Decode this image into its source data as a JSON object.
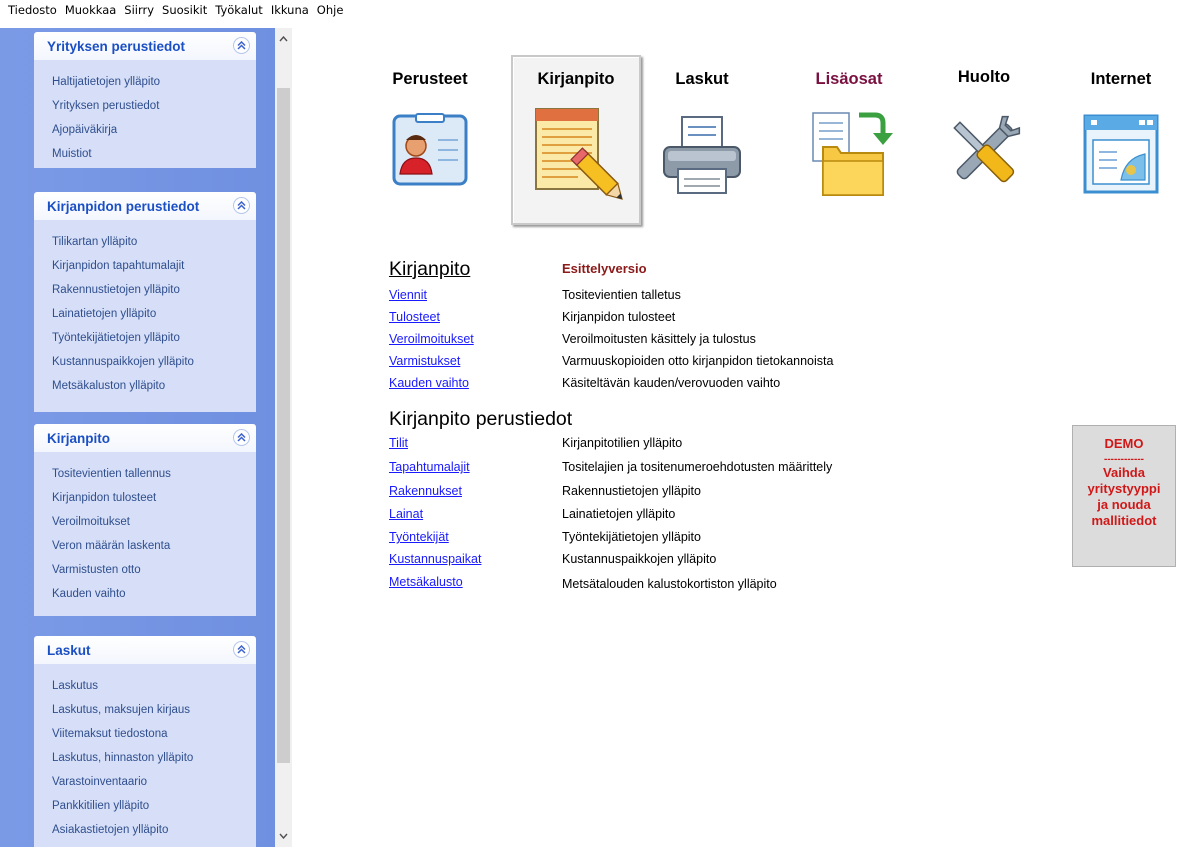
{
  "menu": [
    "Tiedosto",
    "Muokkaa",
    "Siirry",
    "Suosikit",
    "Työkalut",
    "Ikkuna",
    "Ohje"
  ],
  "sidebar": {
    "panels": [
      {
        "title": "Yrityksen perustiedot",
        "items": [
          "Haltijatietojen ylläpito",
          "Yrityksen perustiedot",
          "Ajopäiväkirja",
          "Muistiot"
        ]
      },
      {
        "title": "Kirjanpidon perustiedot",
        "items": [
          "Tilikartan ylläpito",
          "Kirjanpidon tapahtumalajit",
          "Rakennustietojen ylläpito",
          "Lainatietojen ylläpito",
          "Työntekijätietojen ylläpito",
          "Kustannuspaikkojen ylläpito",
          "Metsäkaluston ylläpito"
        ]
      },
      {
        "title": "Kirjanpito",
        "items": [
          "Tositevientien tallennus",
          "Kirjanpidon tulosteet",
          "Veroilmoitukset",
          "Veron määrän laskenta",
          "Varmistusten otto",
          "Kauden vaihto"
        ]
      },
      {
        "title": "Laskut",
        "items": [
          "Laskutus",
          "Laskutus, maksujen kirjaus",
          "Viitemaksut tiedostona",
          "Laskutus, hinnaston ylläpito",
          "Varastoinventaario",
          "Pankkitilien ylläpito",
          "Asiakastietojen ylläpito"
        ]
      }
    ],
    "collapse_glyph": "︽"
  },
  "tabs": [
    {
      "label": "Perusteet",
      "color": "#000000",
      "icon": "person-card-icon"
    },
    {
      "label": "Kirjanpito",
      "color": "#000000",
      "icon": "ledger-pencil-icon",
      "active": true
    },
    {
      "label": "Laskut",
      "color": "#000000",
      "icon": "printer-icon"
    },
    {
      "label": "Lisäosat",
      "color": "#7a1040",
      "icon": "folder-arrow-icon"
    },
    {
      "label": "Huolto",
      "color": "#000000",
      "icon": "tools-icon"
    },
    {
      "label": "Internet",
      "color": "#000000",
      "icon": "browser-window-icon"
    }
  ],
  "content": {
    "section1": {
      "title": "Kirjanpito",
      "badge": "Esittelyversio",
      "rows": [
        {
          "link": "Viennit",
          "desc": "Tositevientien talletus"
        },
        {
          "link": "Tulosteet",
          "desc": "Kirjanpidon tulosteet"
        },
        {
          "link": "Veroilmoitukset",
          "desc": "Veroilmoitusten käsittely ja tulostus"
        },
        {
          "link": "Varmistukset",
          "desc": "Varmuuskopioiden otto kirjanpidon tietokannoista"
        },
        {
          "link": "Kauden vaihto",
          "desc": "Käsiteltävän kauden/verovuoden vaihto"
        }
      ]
    },
    "section2": {
      "title": "Kirjanpito perustiedot",
      "rows": [
        {
          "link": "Tilit",
          "desc": "Kirjanpitotilien ylläpito"
        },
        {
          "link": "Tapahtumalajit",
          "desc": "Tositelajien ja tositenumeroehdotusten määrittely"
        },
        {
          "link": "Rakennukset",
          "desc": "Rakennustietojen ylläpito"
        },
        {
          "link": "Lainat",
          "desc": "Lainatietojen ylläpito"
        },
        {
          "link": "Työntekijät",
          "desc": "Työntekijätietojen ylläpito"
        },
        {
          "link": "Kustannuspaikat",
          "desc": "Kustannuspaikkojen ylläpito"
        },
        {
          "link": "Metsäkalusto",
          "desc": "Metsätalouden kalustokortiston ylläpito"
        }
      ]
    }
  },
  "demo": {
    "title": "DEMO",
    "divider": "------------",
    "lines": [
      "Vaihda",
      "yritystyyppi",
      "ja nouda",
      "mallitiedot"
    ]
  },
  "scrollbar": {
    "up": "▲",
    "down": "▼"
  },
  "colors": {
    "sidebar_bg": "#7b9ae6",
    "panel_title": "#1b4fc4",
    "link": "#1a1aff",
    "badge": "#8b1a1a",
    "demo_text": "#d01818"
  }
}
